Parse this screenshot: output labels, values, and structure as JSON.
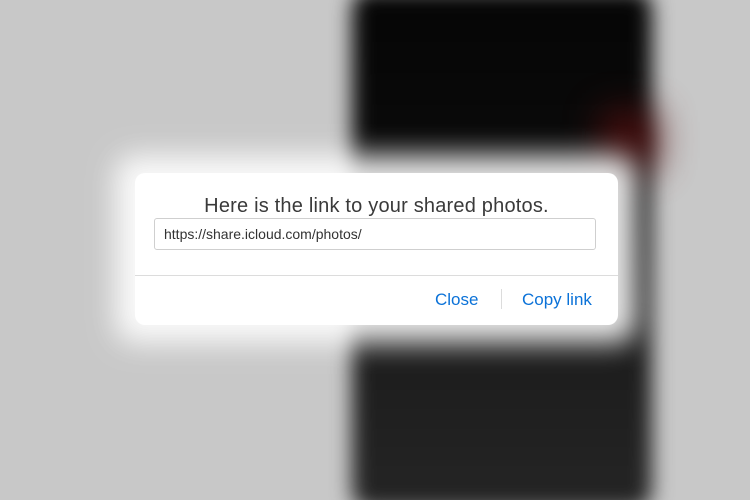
{
  "dialog": {
    "title": "Here is the link to your shared photos.",
    "link_value": "https://share.icloud.com/photos/",
    "close_label": "Close",
    "copy_label": "Copy link"
  },
  "colors": {
    "accent": "#0b72d8",
    "dialog_bg": "#ffffff",
    "overlay": "#c8c8c8"
  }
}
